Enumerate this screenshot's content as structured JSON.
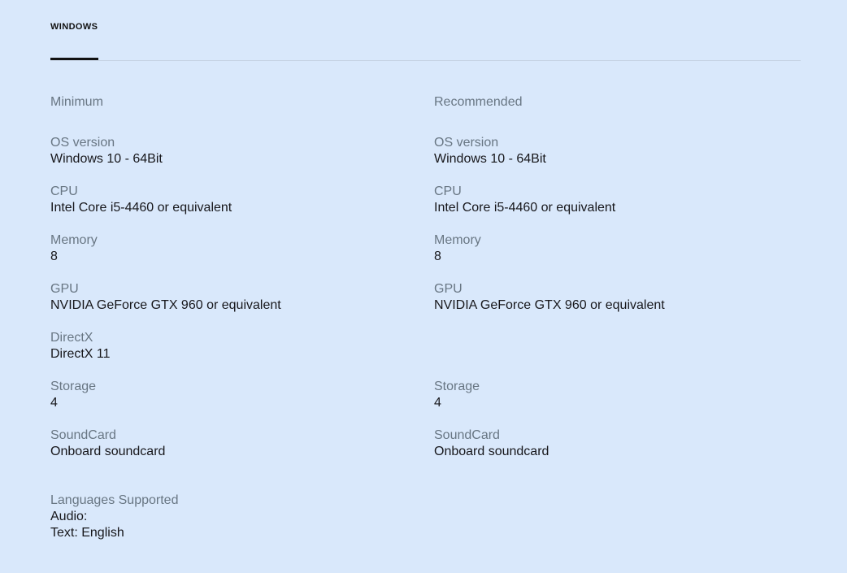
{
  "tabs": [
    {
      "label": "WINDOWS",
      "active": true
    }
  ],
  "minimum": {
    "heading": "Minimum",
    "specs": [
      {
        "label": "OS version",
        "value": "Windows 10 - 64Bit"
      },
      {
        "label": "CPU",
        "value": "Intel Core i5-4460 or equivalent"
      },
      {
        "label": "Memory",
        "value": "8"
      },
      {
        "label": "GPU",
        "value": "NVIDIA GeForce GTX 960 or equivalent"
      },
      {
        "label": "DirectX",
        "value": "DirectX 11"
      },
      {
        "label": "Storage",
        "value": "4"
      },
      {
        "label": "SoundCard",
        "value": "Onboard soundcard"
      }
    ]
  },
  "recommended": {
    "heading": "Recommended",
    "specs": [
      {
        "label": "OS version",
        "value": "Windows 10 - 64Bit"
      },
      {
        "label": "CPU",
        "value": "Intel Core i5-4460 or equivalent"
      },
      {
        "label": "Memory",
        "value": "8"
      },
      {
        "label": "GPU",
        "value": "NVIDIA GeForce GTX 960 or equivalent"
      },
      {
        "label": "",
        "value": ""
      },
      {
        "label": "Storage",
        "value": "4"
      },
      {
        "label": "SoundCard",
        "value": "Onboard soundcard"
      }
    ]
  },
  "languages": {
    "label": "Languages Supported",
    "audio": "Audio:",
    "text": "Text: English"
  },
  "colors": {
    "background": "#d9e8fb",
    "label_gray": "#687683",
    "text_dark": "#17171b",
    "tab_underline": "#121212",
    "divider": "#c6d3e4"
  }
}
